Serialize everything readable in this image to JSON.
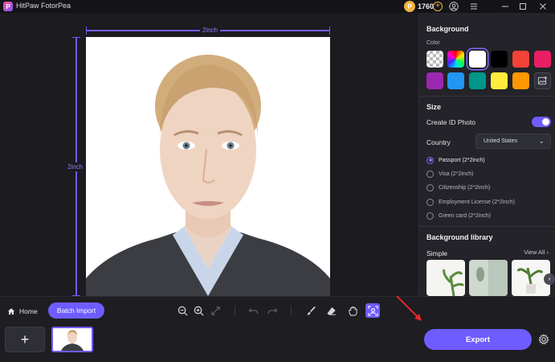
{
  "window": {
    "title": "HitPaw FotorPea",
    "credits": "1760"
  },
  "canvas": {
    "width_label": "2inch",
    "height_label": "2inch"
  },
  "panel": {
    "background_heading": "Background",
    "color_label": "Color",
    "swatches": [
      {
        "name": "transparent",
        "color": "transparent"
      },
      {
        "name": "rainbow",
        "color": "gradient"
      },
      {
        "name": "white",
        "color": "#ffffff",
        "selected": true
      },
      {
        "name": "black",
        "color": "#000000"
      },
      {
        "name": "red",
        "color": "#f44336"
      },
      {
        "name": "pink",
        "color": "#e91e63"
      },
      {
        "name": "purple",
        "color": "#9c27b0"
      },
      {
        "name": "blue",
        "color": "#2196f3"
      },
      {
        "name": "teal",
        "color": "#009688"
      },
      {
        "name": "yellow",
        "color": "#ffeb3b"
      },
      {
        "name": "orange",
        "color": "#ff9800"
      },
      {
        "name": "custom-image",
        "color": "upload"
      }
    ],
    "size_heading": "Size",
    "create_id_label": "Create ID Photo",
    "create_id_enabled": true,
    "country_label": "Country",
    "country_value": "United States",
    "sizes": [
      {
        "label": "Passport (2*2inch)",
        "selected": true
      },
      {
        "label": "Visa (2*2inch)",
        "selected": false
      },
      {
        "label": "Citizenship (2*2inch)",
        "selected": false
      },
      {
        "label": "Employment License (2*2inch)",
        "selected": false
      },
      {
        "label": "Green card (2*2inch)",
        "selected": false
      }
    ],
    "library_heading": "Background library",
    "library_category": "Simple",
    "view_all": "View All"
  },
  "toolbar": {
    "home_label": "Home",
    "batch_import_label": "Batch Import",
    "add_label": "+",
    "export_label": "Export"
  },
  "colors": {
    "accent": "#6f5cff",
    "background": "#1b1b20",
    "panel": "#232329"
  }
}
